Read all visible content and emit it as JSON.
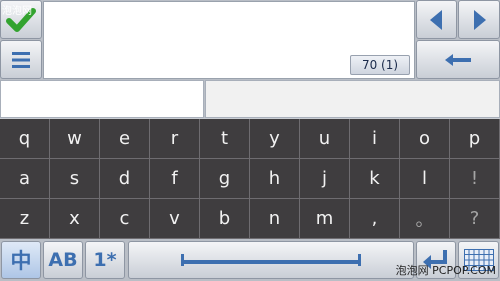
{
  "editor": {
    "text_value": "",
    "char_counter": "70 (1)"
  },
  "candidates": {
    "left": "",
    "right": ""
  },
  "keyboard": {
    "rows": [
      [
        "q",
        "w",
        "e",
        "r",
        "t",
        "y",
        "u",
        "i",
        "o",
        "p"
      ],
      [
        "a",
        "s",
        "d",
        "f",
        "g",
        "h",
        "j",
        "k",
        "l",
        "!"
      ],
      [
        "z",
        "x",
        "c",
        "v",
        "b",
        "n",
        "m",
        ",",
        "。",
        "?"
      ]
    ],
    "bottom": {
      "chinese_mode_label": "中",
      "ab_mode_label": "AB",
      "number_mode_label": "1*",
      "enter_label": "↵"
    }
  },
  "watermark": "泡泡网 PCPOP.COM",
  "top_left_label": "泡泡网",
  "icons": [
    "checkmark-icon",
    "menu-icon",
    "arrow-left-icon",
    "arrow-right-icon",
    "backspace-icon",
    "space-bar-icon",
    "enter-icon",
    "grid-keyboard-icon"
  ],
  "colors": {
    "keyboard_bg": "#3f3d3f",
    "accent_blue": "#3d6fb0",
    "check_green": "#33a32f"
  }
}
